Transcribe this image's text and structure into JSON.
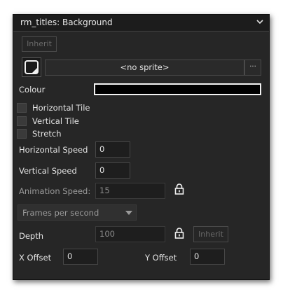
{
  "panel": {
    "title": "rm_titles: Background"
  },
  "inherit_top": "Inherit",
  "sprite": {
    "value": "<no sprite>",
    "more": "···"
  },
  "colour": {
    "label": "Colour",
    "value": "#000000"
  },
  "checkboxes": {
    "horizontal_tile": "Horizontal Tile",
    "vertical_tile": "Vertical Tile",
    "stretch": "Stretch"
  },
  "horizontal_speed": {
    "label": "Horizontal Speed",
    "value": "0"
  },
  "vertical_speed": {
    "label": "Vertical Speed",
    "value": "0"
  },
  "animation_speed": {
    "label": "Animation Speed:",
    "value": "15"
  },
  "speed_units": {
    "selected": "Frames per second"
  },
  "depth": {
    "label": "Depth",
    "value": "100",
    "inherit": "Inherit"
  },
  "x_offset": {
    "label": "X Offset",
    "value": "0"
  },
  "y_offset": {
    "label": "Y Offset",
    "value": "0"
  },
  "colors": {
    "panel_bg": "#262626",
    "field_bg": "#1e1e1e",
    "text": "#e4e4e4",
    "disabled_text": "#8a8a8a"
  }
}
